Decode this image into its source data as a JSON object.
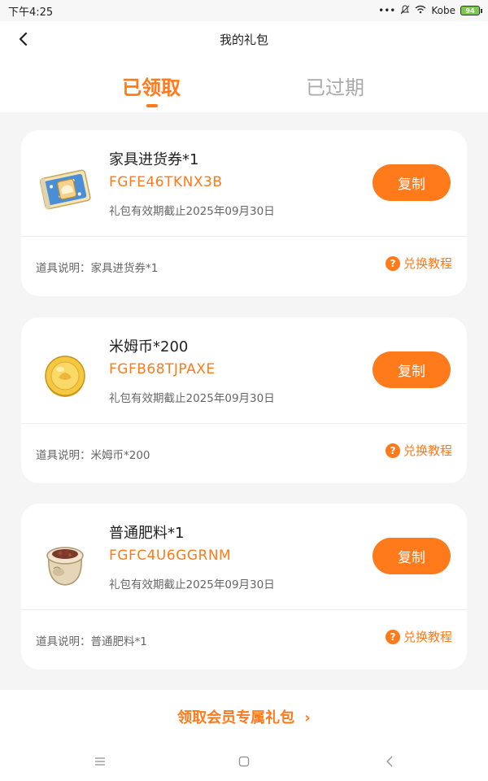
{
  "status_bar": {
    "time": "下午4:25",
    "carrier": "Kobe",
    "battery": "94"
  },
  "header": {
    "title": "我的礼包",
    "tabs": [
      {
        "label": "已领取"
      },
      {
        "label": "已过期"
      }
    ]
  },
  "cards": [
    {
      "name": "家具进货券*1",
      "code": "FGFE46TKNX3B",
      "expiry": "礼包有效期截止2025年09月30日",
      "copy_label": "复制",
      "desc": "道具说明：家具进货券*1",
      "tutorial_label": "兑换教程",
      "icon": "furniture-voucher-icon"
    },
    {
      "name": "米姆币*200",
      "code": "FGFB68TJPAXE",
      "expiry": "礼包有效期截止2025年09月30日",
      "copy_label": "复制",
      "desc": "道具说明：米姆币*200",
      "tutorial_label": "兑换教程",
      "icon": "coin-icon"
    },
    {
      "name": "普通肥料*1",
      "code": "FGFC4U6GGRNM",
      "expiry": "礼包有效期截止2025年09月30日",
      "copy_label": "复制",
      "desc": "道具说明：普通肥料*1",
      "tutorial_label": "兑换教程",
      "icon": "fertilizer-bag-icon"
    }
  ],
  "footer": {
    "vip_link": "领取会员专属礼包"
  },
  "colors": {
    "accent": "#ff7a1a",
    "background": "#f5f5f5"
  }
}
